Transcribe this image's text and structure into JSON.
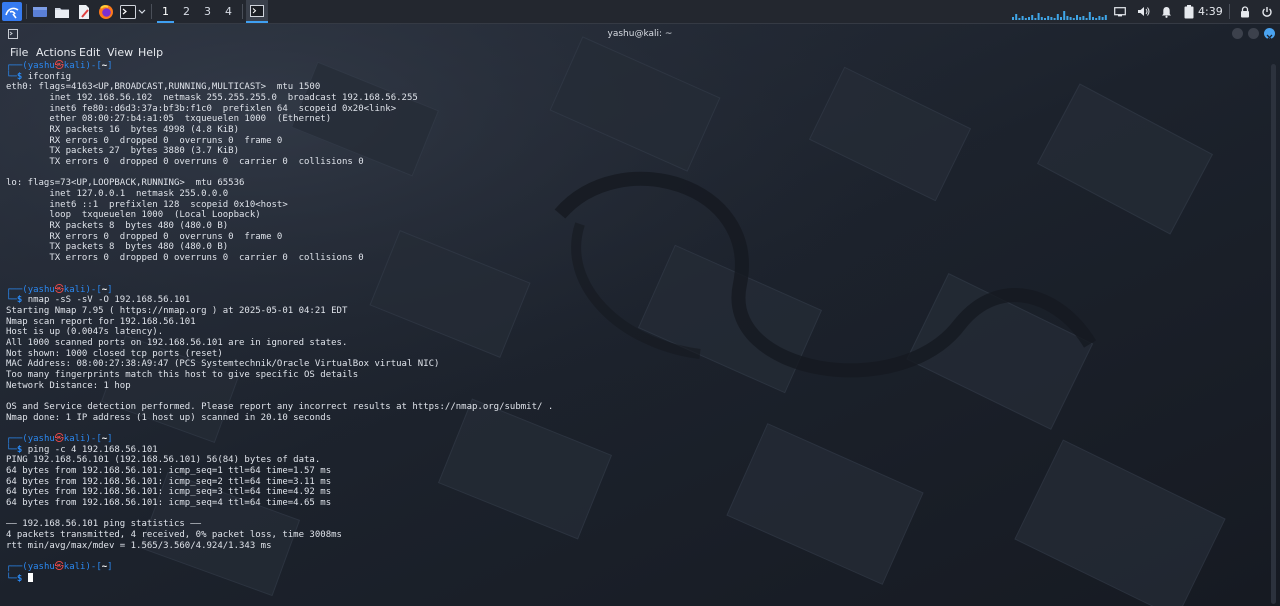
{
  "panel": {
    "workspaces": [
      "1",
      "2",
      "3",
      "4"
    ],
    "active_workspace": "1",
    "clock": "4:39",
    "icons": [
      "kali-menu-icon",
      "desktop-icon",
      "file-manager-icon",
      "text-editor-icon",
      "firefox-icon",
      "terminal-icon",
      "chevron-down-icon"
    ]
  },
  "window": {
    "title": "yashu@kali: ~",
    "menu": [
      "File",
      "Actions",
      "Edit",
      "View",
      "Help"
    ]
  },
  "prompt": {
    "user": "yashu",
    "at": "㉿",
    "host": "kali",
    "dir": "~",
    "symbol": "$"
  },
  "blocks": [
    {
      "command": "ifconfig",
      "output": [
        "eth0: flags=4163<UP,BROADCAST,RUNNING,MULTICAST>  mtu 1500",
        "        inet 192.168.56.102  netmask 255.255.255.0  broadcast 192.168.56.255",
        "        inet6 fe80::d6d3:37a:bf3b:f1c0  prefixlen 64  scopeid 0x20<link>",
        "        ether 08:00:27:b4:a1:05  txqueuelen 1000  (Ethernet)",
        "        RX packets 16  bytes 4998 (4.8 KiB)",
        "        RX errors 0  dropped 0  overruns 0  frame 0",
        "        TX packets 27  bytes 3880 (3.7 KiB)",
        "        TX errors 0  dropped 0 overruns 0  carrier 0  collisions 0",
        "",
        "lo: flags=73<UP,LOOPBACK,RUNNING>  mtu 65536",
        "        inet 127.0.0.1  netmask 255.0.0.0",
        "        inet6 ::1  prefixlen 128  scopeid 0x10<host>",
        "        loop  txqueuelen 1000  (Local Loopback)",
        "        RX packets 8  bytes 480 (480.0 B)",
        "        RX errors 0  dropped 0  overruns 0  frame 0",
        "        TX packets 8  bytes 480 (480.0 B)",
        "        TX errors 0  dropped 0 overruns 0  carrier 0  collisions 0",
        "",
        ""
      ]
    },
    {
      "command": "nmap -sS -sV -O 192.168.56.101",
      "output": [
        "Starting Nmap 7.95 ( https://nmap.org ) at 2025-05-01 04:21 EDT",
        "Nmap scan report for 192.168.56.101",
        "Host is up (0.0047s latency).",
        "All 1000 scanned ports on 192.168.56.101 are in ignored states.",
        "Not shown: 1000 closed tcp ports (reset)",
        "MAC Address: 08:00:27:38:A9:47 (PCS Systemtechnik/Oracle VirtualBox virtual NIC)",
        "Too many fingerprints match this host to give specific OS details",
        "Network Distance: 1 hop",
        "",
        "OS and Service detection performed. Please report any incorrect results at https://nmap.org/submit/ .",
        "Nmap done: 1 IP address (1 host up) scanned in 20.10 seconds",
        ""
      ]
    },
    {
      "command": "ping -c 4 192.168.56.101",
      "output": [
        "PING 192.168.56.101 (192.168.56.101) 56(84) bytes of data.",
        "64 bytes from 192.168.56.101: icmp_seq=1 ttl=64 time=1.57 ms",
        "64 bytes from 192.168.56.101: icmp_seq=2 ttl=64 time=3.11 ms",
        "64 bytes from 192.168.56.101: icmp_seq=3 ttl=64 time=4.92 ms",
        "64 bytes from 192.168.56.101: icmp_seq=4 ttl=64 time=4.65 ms",
        "",
        "—— 192.168.56.101 ping statistics ——",
        "4 packets transmitted, 4 received, 0% packet loss, time 3008ms",
        "rtt min/avg/max/mdev = 1.565/3.560/4.924/1.343 ms",
        ""
      ]
    },
    {
      "command": "",
      "output": []
    }
  ],
  "colors": {
    "prompt_blue": "#2b88f0",
    "prompt_red": "#f04b4b",
    "accent": "#3fa0f2"
  }
}
